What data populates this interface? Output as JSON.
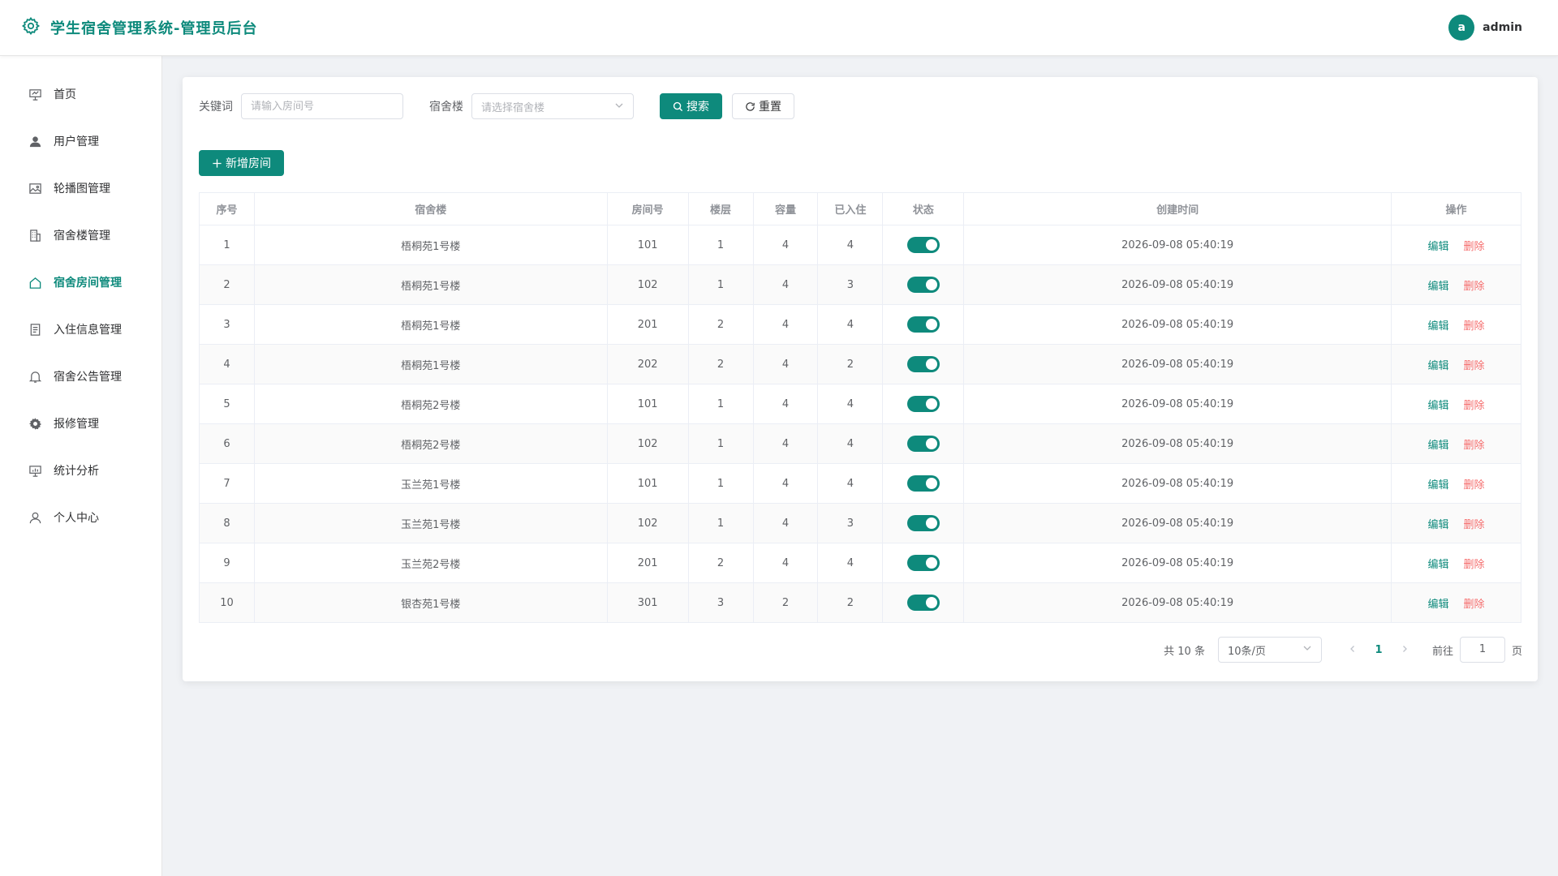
{
  "app": {
    "title": "学生宿舍管理系统-管理员后台",
    "user_avatar_letter": "a",
    "username": "admin",
    "accent_color": "#0e8a7c",
    "danger_color": "#f56c6c"
  },
  "sidebar": {
    "items": [
      {
        "label": "首页",
        "icon": "dashboard-icon",
        "active": false
      },
      {
        "label": "用户管理",
        "icon": "user-icon",
        "active": false
      },
      {
        "label": "轮播图管理",
        "icon": "picture-icon",
        "active": false
      },
      {
        "label": "宿舍楼管理",
        "icon": "building-icon",
        "active": false
      },
      {
        "label": "宿舍房间管理",
        "icon": "house-icon",
        "active": true
      },
      {
        "label": "入住信息管理",
        "icon": "document-icon",
        "active": false
      },
      {
        "label": "宿舍公告管理",
        "icon": "bell-icon",
        "active": false
      },
      {
        "label": "报修管理",
        "icon": "gear-icon",
        "active": false
      },
      {
        "label": "统计分析",
        "icon": "chart-icon",
        "active": false
      },
      {
        "label": "个人中心",
        "icon": "person-icon",
        "active": false
      }
    ]
  },
  "search": {
    "keyword_label": "关键词",
    "keyword_placeholder": "请输入房间号",
    "keyword_value": "",
    "building_label": "宿舍楼",
    "building_placeholder": "请选择宿舍楼",
    "search_button": "搜索",
    "reset_button": "重置"
  },
  "toolbar": {
    "add_button": "新增房间"
  },
  "table": {
    "columns": [
      "序号",
      "宿舍楼",
      "房间号",
      "楼层",
      "容量",
      "已入住",
      "状态",
      "创建时间",
      "操作"
    ],
    "edit_label": "编辑",
    "delete_label": "删除",
    "rows": [
      {
        "index": "1",
        "building": "梧桐苑1号楼",
        "room": "101",
        "floor": "1",
        "capacity": "4",
        "occupied": "4",
        "status": true,
        "created": "2026-09-08 05:40:19"
      },
      {
        "index": "2",
        "building": "梧桐苑1号楼",
        "room": "102",
        "floor": "1",
        "capacity": "4",
        "occupied": "3",
        "status": true,
        "created": "2026-09-08 05:40:19"
      },
      {
        "index": "3",
        "building": "梧桐苑1号楼",
        "room": "201",
        "floor": "2",
        "capacity": "4",
        "occupied": "4",
        "status": true,
        "created": "2026-09-08 05:40:19"
      },
      {
        "index": "4",
        "building": "梧桐苑1号楼",
        "room": "202",
        "floor": "2",
        "capacity": "4",
        "occupied": "2",
        "status": true,
        "created": "2026-09-08 05:40:19"
      },
      {
        "index": "5",
        "building": "梧桐苑2号楼",
        "room": "101",
        "floor": "1",
        "capacity": "4",
        "occupied": "4",
        "status": true,
        "created": "2026-09-08 05:40:19"
      },
      {
        "index": "6",
        "building": "梧桐苑2号楼",
        "room": "102",
        "floor": "1",
        "capacity": "4",
        "occupied": "4",
        "status": true,
        "created": "2026-09-08 05:40:19"
      },
      {
        "index": "7",
        "building": "玉兰苑1号楼",
        "room": "101",
        "floor": "1",
        "capacity": "4",
        "occupied": "4",
        "status": true,
        "created": "2026-09-08 05:40:19"
      },
      {
        "index": "8",
        "building": "玉兰苑1号楼",
        "room": "102",
        "floor": "1",
        "capacity": "4",
        "occupied": "3",
        "status": true,
        "created": "2026-09-08 05:40:19"
      },
      {
        "index": "9",
        "building": "玉兰苑2号楼",
        "room": "201",
        "floor": "2",
        "capacity": "4",
        "occupied": "4",
        "status": true,
        "created": "2026-09-08 05:40:19"
      },
      {
        "index": "10",
        "building": "银杏苑1号楼",
        "room": "301",
        "floor": "3",
        "capacity": "2",
        "occupied": "2",
        "status": true,
        "created": "2026-09-08 05:40:19"
      }
    ]
  },
  "pagination": {
    "total_text": "共 10 条",
    "page_size": "10条/页",
    "current_page": "1",
    "goto_label": "前往",
    "goto_value": "1",
    "page_unit": "页"
  }
}
